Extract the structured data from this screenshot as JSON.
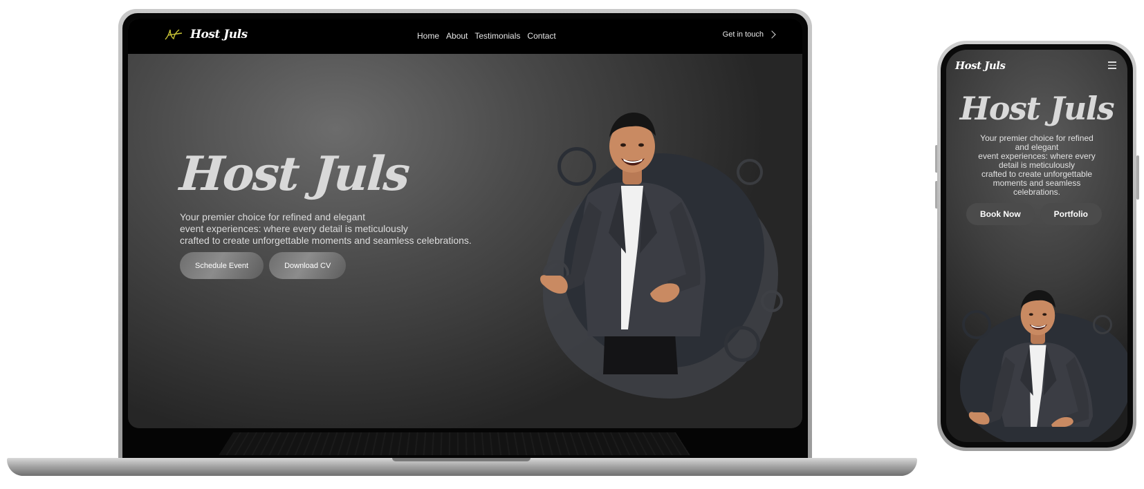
{
  "laptop": {
    "nav": {
      "brand_name": "Host Juls",
      "links": [
        "Home",
        "About",
        "Testimonials",
        "Contact"
      ],
      "cta_label": "Get in touch",
      "cta_icon": "chevron-right-icon"
    },
    "hero": {
      "title": "Host Juls",
      "copy_lines": [
        "Your premier choice for refined and elegant",
        "event experiences: where every detail is meticulously",
        "crafted to create unforgettable moments and seamless celebrations."
      ],
      "primary_button": "Schedule Event",
      "secondary_button": "Download CV"
    }
  },
  "phone": {
    "brand_name": "Host Juls",
    "menu_icon": "hamburger-menu-icon",
    "title": "Host Juls",
    "copy_lines": [
      "Your premier choice for refined",
      "and elegant",
      "event experiences: where every",
      "detail is meticulously",
      "crafted to create unforgettable",
      "moments and seamless",
      "celebrations."
    ],
    "primary_button": "Book Now",
    "secondary_button": "Portfolio"
  },
  "colors": {
    "brand_mark": "#c9c436",
    "hero_text": "#d9d9d9",
    "blob_dark": "#2b2f36"
  }
}
